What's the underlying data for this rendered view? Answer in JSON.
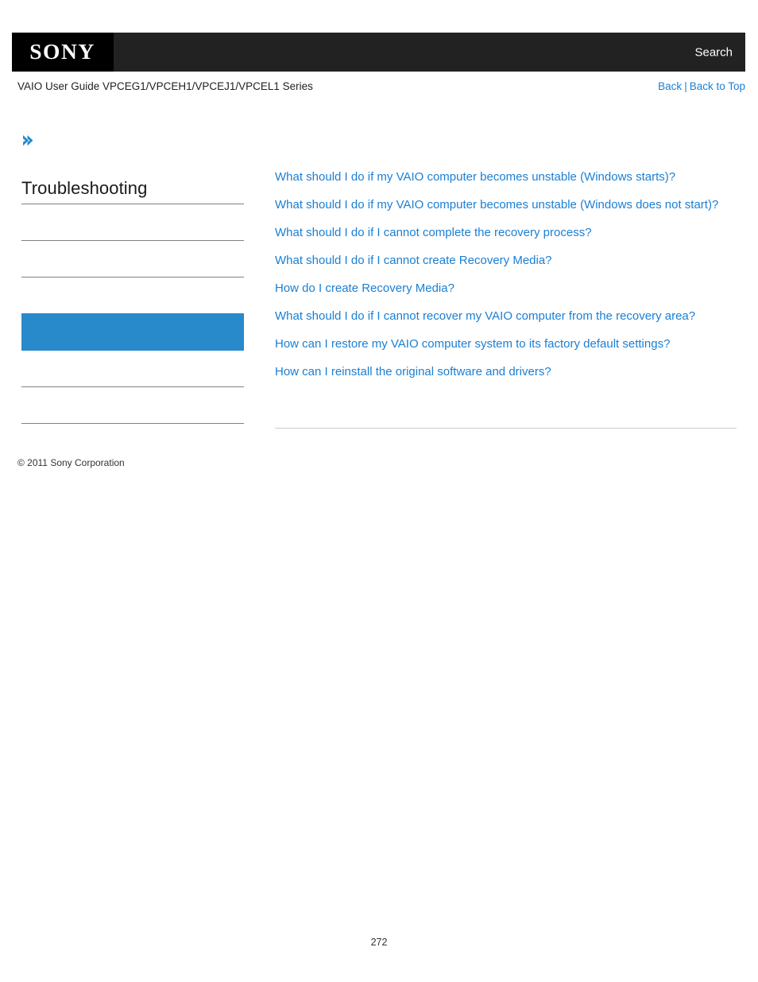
{
  "header": {
    "logo_text": "SONY",
    "search_label": "Search",
    "logo_bg": "#000000",
    "bar_bg": "#222222"
  },
  "sub_header": {
    "guide_title": "VAIO User Guide VPCEG1/VPCEH1/VPCEJ1/VPCEL1 Series",
    "back_label": "Back",
    "separator": "|",
    "back_to_top_label": "Back to Top",
    "link_color": "#1a7fd4"
  },
  "sidebar": {
    "breadcrumb_arrow_icon": "double-chevron-right-icon",
    "title": "Troubleshooting",
    "accent_color": "#2889cb",
    "items": [
      {
        "label": "",
        "active": false
      },
      {
        "label": "",
        "active": false
      },
      {
        "label": "",
        "active": false
      },
      {
        "label": "",
        "active": true
      },
      {
        "label": "",
        "active": false
      },
      {
        "label": "",
        "active": false
      }
    ]
  },
  "content": {
    "links": [
      "What should I do if my VAIO computer becomes unstable (Windows starts)?",
      "What should I do if my VAIO computer becomes unstable (Windows does not start)?",
      "What should I do if I cannot complete the recovery process?",
      "What should I do if I cannot create Recovery Media?",
      "How do I create Recovery Media?",
      "What should I do if I cannot recover my VAIO computer from the recovery area?",
      "How can I restore my VAIO computer system to its factory default settings?",
      "How can I reinstall the original software and drivers?"
    ]
  },
  "footer": {
    "copyright": "© 2011 Sony Corporation",
    "page_number": "272"
  }
}
